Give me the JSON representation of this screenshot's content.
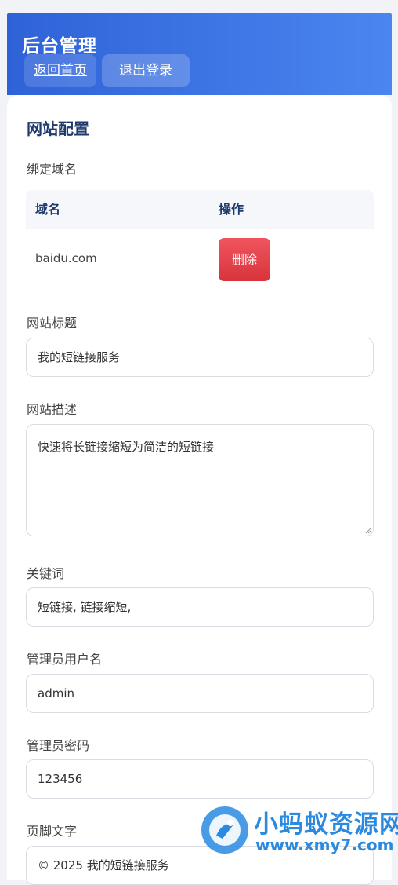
{
  "header": {
    "title": "后台管理",
    "home_label": "返回首页",
    "logout_label": "退出登录"
  },
  "config": {
    "section_title": "网站配置",
    "domains": {
      "label": "绑定域名",
      "columns": [
        "域名",
        "操作"
      ],
      "rows": [
        {
          "domain": "baidu.com",
          "action_label": "删除"
        }
      ]
    },
    "site_title": {
      "label": "网站标题",
      "value": "我的短链接服务"
    },
    "site_description": {
      "label": "网站描述",
      "value": "快速将长链接缩短为简洁的短链接"
    },
    "keywords": {
      "label": "关键词",
      "value": "短链接, 链接缩短,"
    },
    "admin_username": {
      "label": "管理员用户名",
      "value": "admin"
    },
    "admin_password": {
      "label": "管理员密码",
      "value": "123456"
    },
    "footer_text": {
      "label": "页脚文字",
      "value": "© 2025 我的短链接服务"
    }
  },
  "watermark": {
    "name": "小蚂蚁资源网",
    "url": "www.xmy7.com"
  },
  "colors": {
    "header_start": "#2f62d8",
    "header_end": "#4a86f0",
    "section_title": "#1e3a6e",
    "delete_button": "#e2434b",
    "watermark": "#2a8ae0"
  }
}
